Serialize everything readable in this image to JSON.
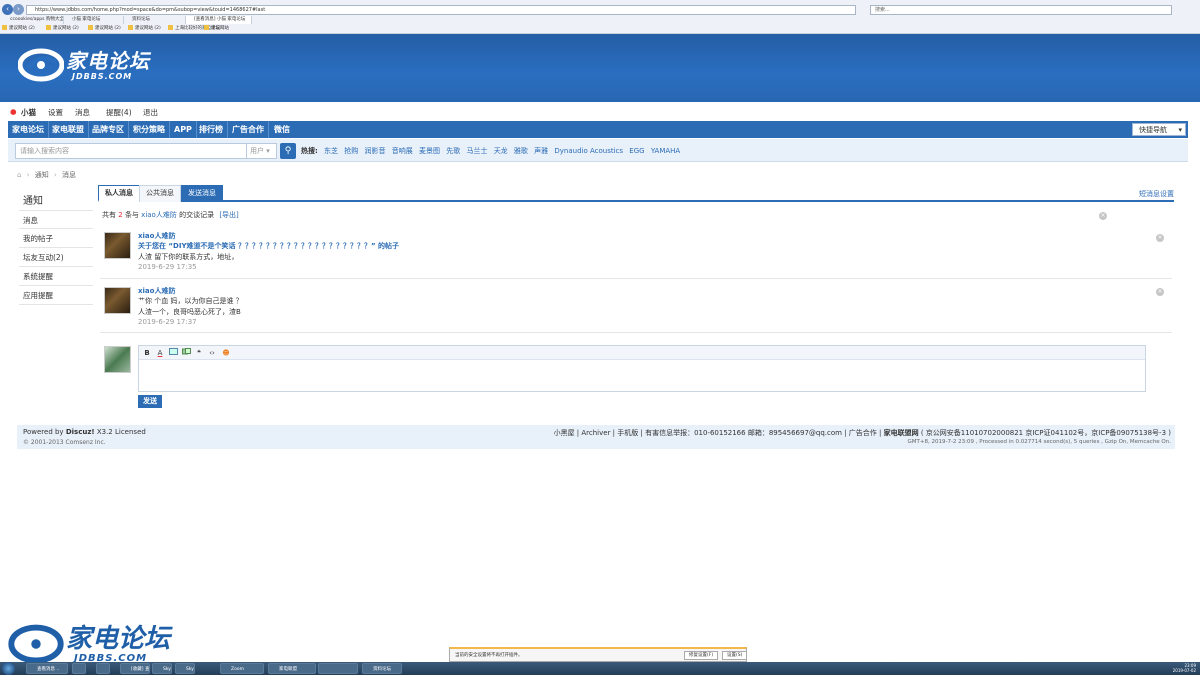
{
  "browser": {
    "address": "https://www.jdbbs.com/home.php?mod=space&do=pm&subop=view&touid=1468627#last",
    "search_placeholder": "搜索...",
    "tabs": [
      {
        "label": "ccoookies/apps 购物大全站"
      },
      {
        "label": "小猫 家电论坛"
      },
      {
        "label": "资料论坛"
      },
      {
        "label": "[查看消息] 小猫 家电论坛"
      }
    ],
    "favorites": [
      {
        "label": "建议网站 (2)"
      },
      {
        "label": "建议网站 (2)"
      },
      {
        "label": "建议网站 (2)"
      },
      {
        "label": "建议网站 (2)"
      },
      {
        "label": "上海比较好的家电论坛..."
      },
      {
        "label": "建议网站"
      }
    ]
  },
  "site": {
    "logo_text": "家电论坛",
    "logo_sub": "JDBBS.COM"
  },
  "userbar": {
    "username": "小猫",
    "links": [
      "设置",
      "消息",
      "提醒(4)",
      "退出"
    ]
  },
  "mainnav": {
    "items": [
      "家电论坛",
      "家电联盟",
      "品牌专区",
      "积分策略",
      "APP",
      "排行榜",
      "广告合作",
      "微信"
    ],
    "quick_nav": "快捷导航"
  },
  "search": {
    "placeholder": "请输入搜索内容",
    "type": "用户",
    "hot_label": "热搜:",
    "hot_words": [
      "东芝",
      "抢购",
      "润影音",
      "音响展",
      "麦景图",
      "先歌",
      "马兰士",
      "天龙",
      "雅歌",
      "声雅",
      "Dynaudio Acoustics",
      "EGG",
      "YAMAHA"
    ]
  },
  "breadcrumb": {
    "items": [
      "通知",
      "消息"
    ]
  },
  "sidebar": {
    "title": "通知",
    "items": [
      "消息",
      "我的帖子",
      "坛友互动(2)",
      "系统提醒",
      "应用提醒"
    ]
  },
  "tabs": {
    "private": "私人消息",
    "public": "公共消息",
    "send": "发送消息",
    "settings": "短消息设置"
  },
  "summary": {
    "prefix": "共有",
    "count": "2",
    "middle": "条与",
    "user": "xiao人难防",
    "suffix": "的交谈记录",
    "export": "[导出]"
  },
  "messages": [
    {
      "author": "xiao人难防",
      "line1": "关于您在 “DIY难道不是个笑话 ？？？？？？？？？？？？？？？？？？？” 的帖子",
      "line2": "人渣 留下你的联系方式，地址，",
      "time": "2019-6-29 17:35"
    },
    {
      "author": "xiao人难防",
      "line1": "艹你 个血 妈，以为你自己是谁 ？",
      "line2": "人渣一个，良哥吗恶心死了，渣B",
      "time": "2019-6-29 17:37"
    }
  ],
  "editor": {
    "send_label": "发送"
  },
  "footer": {
    "powered_prefix": "Powered by",
    "powered_brand": "Discuz!",
    "powered_suffix": "X3.2 Licensed",
    "copyright": "© 2001-2013 Comsenz Inc.",
    "links": "小黑屋 | Archiver | 手机版 | 有害信息举报：010-60152166 邮箱：895456697@qq.com | 广告合作 |",
    "site_name": "家电联盟网",
    "icp": "( 京公网安备11010702000821 京ICP证041102号，京ICP备09075138号-3 )",
    "stats": "GMT+8, 2019-7-2 23:09 , Processed in 0.027714 second(s), 5 queries , Gzip On, Memcache On."
  },
  "notification": {
    "text": "当前的安全设置将不再打开插件。",
    "btn1": "修复设置(F)",
    "btn2": "设置(S)"
  },
  "taskbar": {
    "tasks": [
      "查看消息 ..",
      "",
      "",
      "[收藏] 查看...",
      "Skype",
      "Skype",
      "Zoom",
      "家电联盟",
      "",
      "Skype",
      "资料论坛"
    ],
    "clock_time": "23:09",
    "clock_date": "2019-07-02"
  },
  "colors": {
    "brand_blue": "#2b6cb5",
    "banner_blue": "#2a6ec0"
  }
}
